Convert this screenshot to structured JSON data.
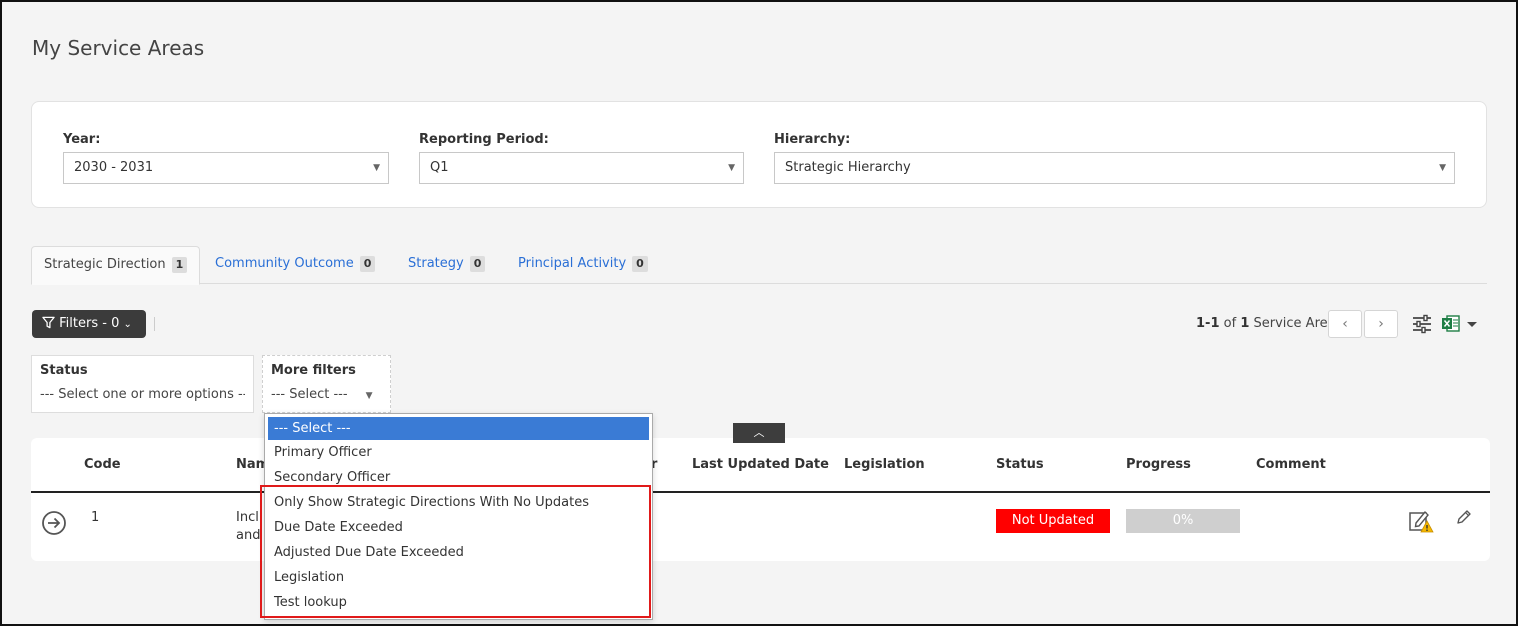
{
  "page": {
    "title": "My Service Areas"
  },
  "top_filters": {
    "year": {
      "label": "Year:",
      "value": "2030 - 2031"
    },
    "period": {
      "label": "Reporting Period:",
      "value": "Q1"
    },
    "hierarchy": {
      "label": "Hierarchy:",
      "value": "Strategic Hierarchy"
    }
  },
  "tabs": [
    {
      "label": "Strategic Direction",
      "count": "1"
    },
    {
      "label": "Community Outcome",
      "count": "0"
    },
    {
      "label": "Strategy",
      "count": "0"
    },
    {
      "label": "Principal Activity",
      "count": "0"
    }
  ],
  "toolbar": {
    "filters_label": "Filters - 0",
    "pager_range": "1-1",
    "pager_of": "of",
    "pager_total": "1",
    "pager_unit": "Service Area"
  },
  "filter_panels": {
    "status": {
      "label": "Status",
      "placeholder": "--- Select one or more options ---"
    },
    "more": {
      "label": "More filters",
      "placeholder": "--- Select ---"
    }
  },
  "dropdown": {
    "items": [
      "--- Select ---",
      "Primary Officer",
      "Secondary Officer",
      "Only Show Strategic Directions With No Updates",
      "Due Date Exceeded",
      "Adjusted Due Date Exceeded",
      "Legislation",
      "Test lookup"
    ]
  },
  "table": {
    "columns": {
      "code": "Code",
      "name": "Nam",
      "officer": "r",
      "last_updated": "Last Updated Date",
      "legislation": "Legislation",
      "status": "Status",
      "progress": "Progress",
      "comment": "Comment"
    },
    "row": {
      "code": "1",
      "name_line1": "Incl",
      "name_line2": "and",
      "status": "Not Updated",
      "progress": "0%"
    }
  },
  "colors": {
    "accent": "#2a6fd6",
    "status_not_updated": "#ff0000",
    "dropdown_selected": "#3a7bd5",
    "highlight": "#e01a1a"
  }
}
